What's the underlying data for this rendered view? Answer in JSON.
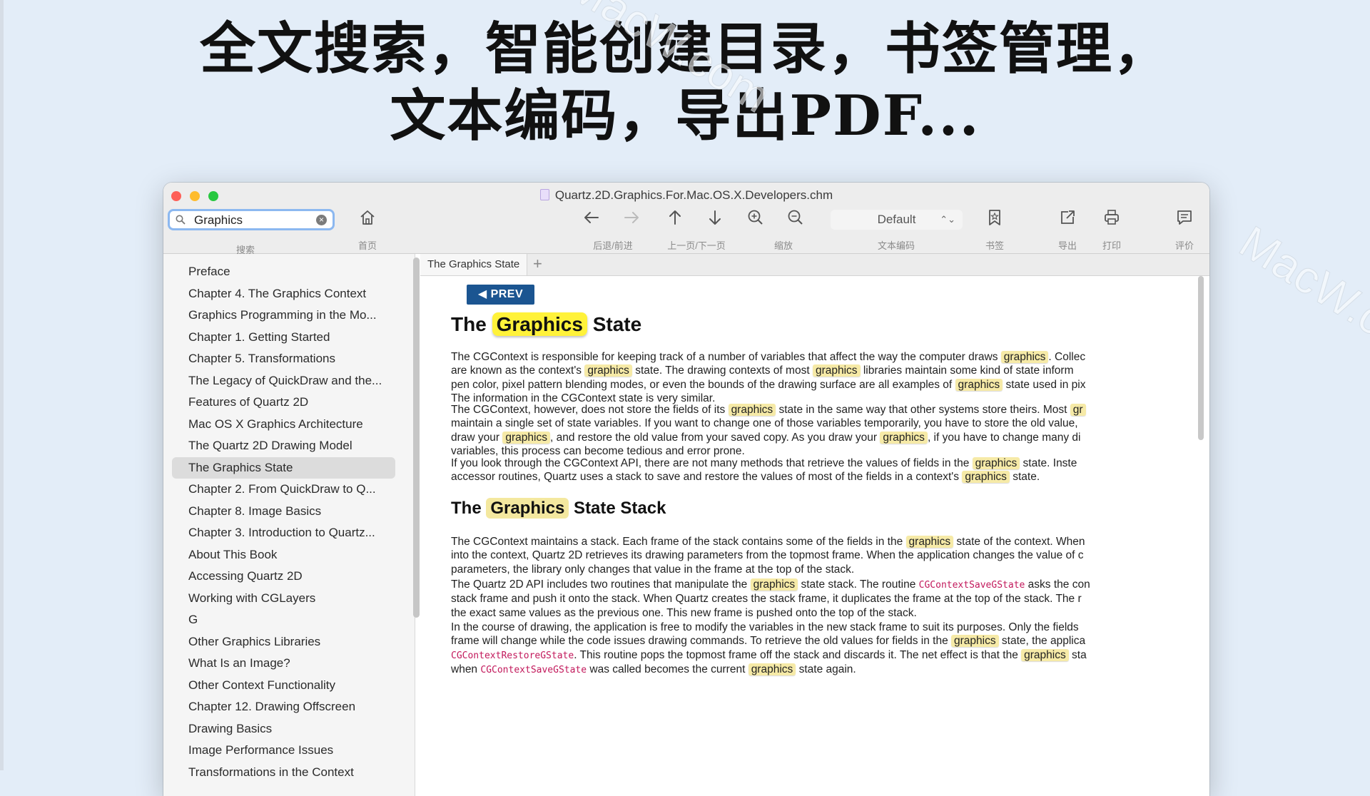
{
  "headline": {
    "line1": "全文搜索，智能创建目录，书签管理，",
    "line2": "文本编码，导出PDF..."
  },
  "watermark": "MacW.com",
  "window": {
    "title": "Quartz.2D.Graphics.For.Mac.OS.X.Developers.chm"
  },
  "toolbar": {
    "search_value": "Graphics",
    "search_label": "搜索",
    "home_label": "首页",
    "backforward_label": "后退/前进",
    "prevnext_label": "上一页/下一页",
    "zoom_label": "缩放",
    "encoding_value": "Default",
    "encoding_label": "文本编码",
    "bookmark_label": "书签",
    "export_label": "导出",
    "print_label": "打印",
    "review_label": "评价"
  },
  "sidebar": {
    "items": [
      "Preface",
      "Chapter 4.  The Graphics Context",
      "Graphics Programming in the Mo...",
      "Chapter 1.  Getting Started",
      "Chapter 5.  Transformations",
      "The Legacy of QuickDraw and the...",
      "Features of Quartz 2D",
      "Mac OS X Graphics Architecture",
      "The Quartz 2D Drawing Model",
      "The Graphics State",
      "Chapter 2.  From QuickDraw to Q...",
      "Chapter 8.  Image Basics",
      "Chapter 3.  Introduction to Quartz...",
      "About This Book",
      "Accessing Quartz 2D",
      "Working with CGLayers",
      "G",
      "Other Graphics Libraries",
      "What Is an Image?",
      "Other Context Functionality",
      "Chapter 12.  Drawing Offscreen",
      "Drawing Basics",
      "Image Performance Issues",
      "Transformations in the Context"
    ],
    "selected_index": 9
  },
  "tabs": {
    "active": "The Graphics State",
    "add": "+"
  },
  "content": {
    "prev_label": "PREV",
    "h1": {
      "before": "The ",
      "highlight": "Graphics",
      "after": " State"
    },
    "h2": {
      "before": "The ",
      "highlight": "Graphics",
      "after": " State Stack"
    },
    "p1": [
      [
        "The CGContext is responsible for keeping track of a number of variables that affect the way the computer draws ",
        "graphics",
        ". Collec"
      ],
      [
        "are known as the context's ",
        "graphics",
        " state. The drawing contexts of most ",
        "graphics",
        " libraries maintain some kind of state inform"
      ],
      [
        "pen color, pixel pattern blending modes, or even the bounds of the drawing surface are all examples of ",
        "graphics",
        " state used in pix"
      ],
      [
        "The information in the CGContext state is very similar."
      ]
    ],
    "p2": [
      [
        "The CGContext, however, does not store the fields of its ",
        "graphics",
        " state in the same way that other systems store theirs. Most ",
        "gr"
      ],
      [
        "maintain a single set of state variables. If you want to change one of those variables temporarily, you have to store the old value,"
      ],
      [
        "draw your ",
        "graphics",
        ", and restore the old value from your saved copy. As you draw your ",
        "graphics",
        ", if you have to change many di"
      ],
      [
        "variables, this process can become tedious and error prone."
      ]
    ],
    "p3": [
      [
        "If you look through the CGContext API, there are not many methods that retrieve the values of fields in the ",
        "graphics",
        " state. Inste"
      ],
      [
        "accessor routines, Quartz uses a stack to save and restore the values of most of the fields in a context's ",
        "graphics",
        " state."
      ]
    ],
    "p4": [
      [
        "The CGContext maintains a stack. Each frame of the stack contains some of the fields in the ",
        "graphics",
        " state of the context. When"
      ],
      [
        "into the context, Quartz 2D retrieves its drawing parameters from the topmost frame. When the application changes the value of c"
      ],
      [
        "parameters, the library only changes that value in the frame at the top of the stack."
      ]
    ],
    "p5": [
      [
        "The Quartz 2D API includes two routines that manipulate the ",
        "graphics",
        " state stack. The routine ",
        "CGContextSaveGState",
        " asks the con"
      ],
      [
        "stack frame and push it onto the stack. When Quartz creates the stack frame, it duplicates the frame at the top of the stack. The r"
      ],
      [
        "the exact same values as the previous one. This new frame is pushed onto the top of the stack."
      ]
    ],
    "p6": [
      [
        "In the course of drawing, the application is free to modify the variables in the new stack frame to suit its purposes. Only the fields"
      ],
      [
        "frame will change while the code issues drawing commands. To retrieve the old values for fields in the ",
        "graphics",
        " state, the applica"
      ],
      [
        "CGContextRestoreGState",
        ". This routine pops the topmost frame off the stack and discards it. The net effect is that the ",
        "graphics",
        " sta"
      ],
      [
        "when ",
        "CGContextSaveGState",
        " was called becomes the current ",
        "graphics",
        " state again."
      ]
    ]
  }
}
